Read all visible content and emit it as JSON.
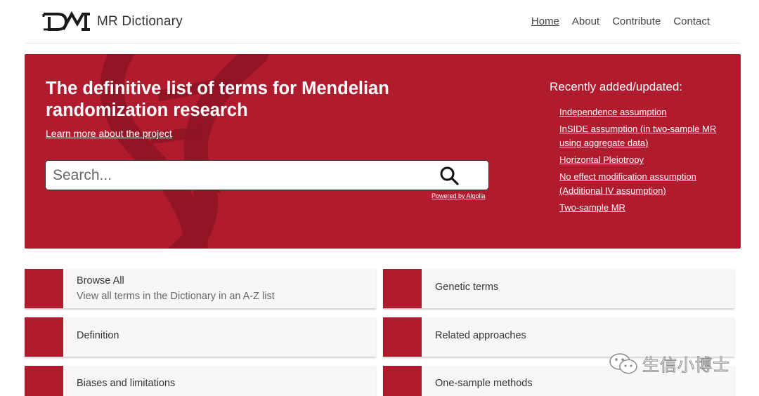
{
  "header": {
    "site_title": "MR Dictionary",
    "nav": [
      {
        "label": "Home",
        "active": true
      },
      {
        "label": "About",
        "active": false
      },
      {
        "label": "Contribute",
        "active": false
      },
      {
        "label": "Contact",
        "active": false
      }
    ]
  },
  "hero": {
    "title": "The definitive list of terms for Mendelian randomization research",
    "learn_more": "Learn more about the project",
    "search_placeholder": "Search...",
    "powered_by": "Powered by Algolia",
    "recent_title": "Recently added/updated:",
    "recent_items": [
      "Independence assumption",
      "InSIDE assumption (in two-sample MR using aggregate data)",
      "Horizontal Pleiotropy",
      "No effect modification assumption (Additional IV assumption)",
      "Two-sample MR"
    ]
  },
  "cards": [
    {
      "title": "Browse All",
      "subtitle": "View all terms in the Dictionary in an A-Z list"
    },
    {
      "title": "Genetic terms",
      "subtitle": ""
    },
    {
      "title": "Definition",
      "subtitle": ""
    },
    {
      "title": "Related approaches",
      "subtitle": ""
    },
    {
      "title": "Biases and limitations",
      "subtitle": ""
    },
    {
      "title": "One-sample methods",
      "subtitle": ""
    }
  ],
  "watermark": {
    "text": "生信小博士",
    "icon": "wechat-icon"
  },
  "colors": {
    "brand": "#b01c2e",
    "card_bg": "#f7f7f7"
  }
}
